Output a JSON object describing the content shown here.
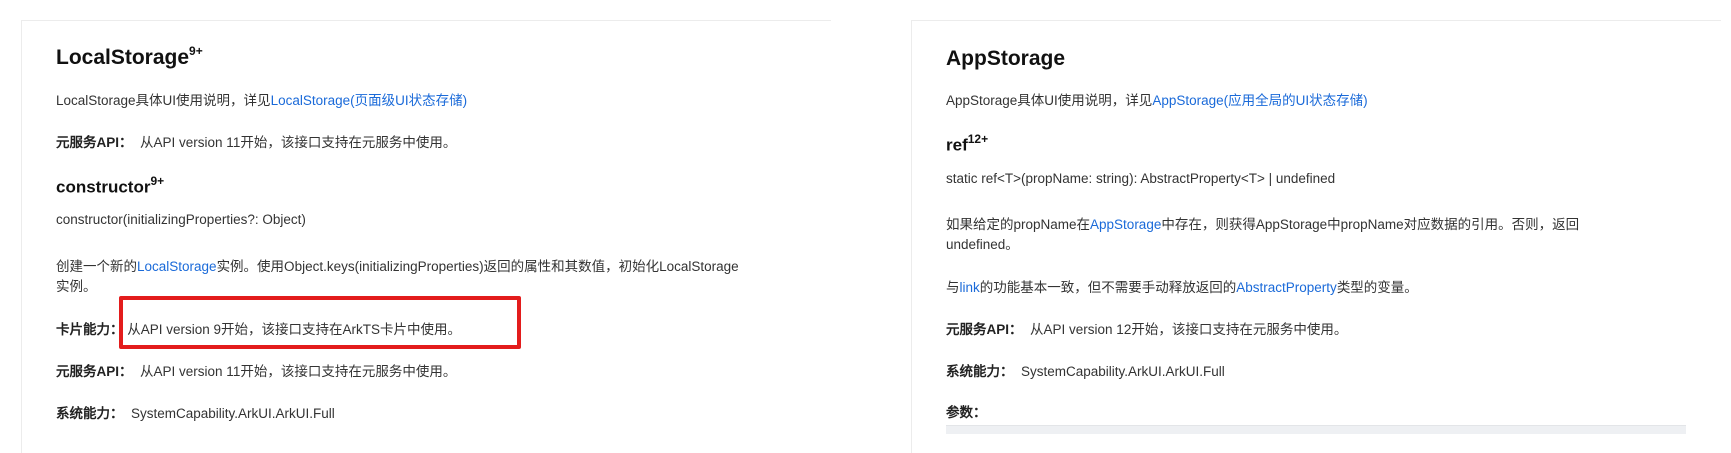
{
  "left": {
    "title": "LocalStorage",
    "title_sup": "9+",
    "intro_prefix": "LocalStorage具体UI使用说明，详见",
    "intro_link": "LocalStorage(页面级UI状态存储)",
    "atomic_label": "元服务API：",
    "atomic_text": "从API version 11开始，该接口支持在元服务中使用。",
    "constructor_title": "constructor",
    "constructor_sup": "9+",
    "constructor_sig": "constructor(initializingProperties?: Object)",
    "desc_prefix": "创建一个新的",
    "desc_link": "LocalStorage",
    "desc_suffix": "实例。使用Object.keys(initializingProperties)返回的属性和其数值，初始化LocalStorage",
    "desc_line2": "实例。",
    "card_label": "卡片能力：",
    "card_text": "从API version 9开始，该接口支持在ArkTS卡片中使用。",
    "atomic2_label": "元服务API：",
    "atomic2_text": "从API version 11开始，该接口支持在元服务中使用。",
    "syscap_label": "系统能力：",
    "syscap_text": "SystemCapability.ArkUI.ArkUI.Full"
  },
  "right": {
    "title": "AppStorage",
    "intro_prefix": "AppStorage具体UI使用说明，详见",
    "intro_link": "AppStorage(应用全局的UI状态存储)",
    "ref_title": "ref",
    "ref_sup": "12+",
    "ref_sig": "static ref<T>(propName: string): AbstractProperty<T> | undefined",
    "p1_prefix": "如果给定的propName在",
    "p1_link": "AppStorage",
    "p1_suffix": "中存在，则获得AppStorage中propName对应数据的引用。否则，返回",
    "p1_line2": "undefined。",
    "p2_prefix": "与",
    "p2_link1": "link",
    "p2_mid": "的功能基本一致，但不需要手动释放返回的",
    "p2_link2": "AbstractProperty",
    "p2_suffix": "类型的变量。",
    "atomic_label": "元服务API：",
    "atomic_text": "从API version 12开始，该接口支持在元服务中使用。",
    "syscap_label": "系统能力：",
    "syscap_text": "SystemCapability.ArkUI.ArkUI.Full",
    "params_label": "参数："
  },
  "colors": {
    "link": "#1a6ad9",
    "highlight": "#e31c1c"
  }
}
